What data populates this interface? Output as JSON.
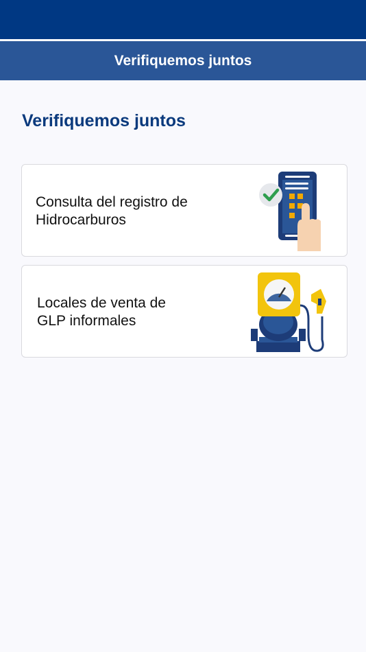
{
  "header": {
    "title": "Verifiquemos juntos"
  },
  "main": {
    "section_title": "Verifiquemos juntos",
    "cards": [
      {
        "line1": "Consulta del registro de",
        "line2": "Hidrocarburos",
        "icon": "phone-check-icon"
      },
      {
        "line1": "Locales de venta de",
        "line2": "GLP informales",
        "icon": "fuel-pump-icon"
      }
    ]
  },
  "colors": {
    "status_bar": "#003883",
    "nav_bar": "#2a5697",
    "title_blue": "#0b3a7d",
    "accent_yellow": "#f2c40d",
    "check_green": "#2e9e4e"
  }
}
